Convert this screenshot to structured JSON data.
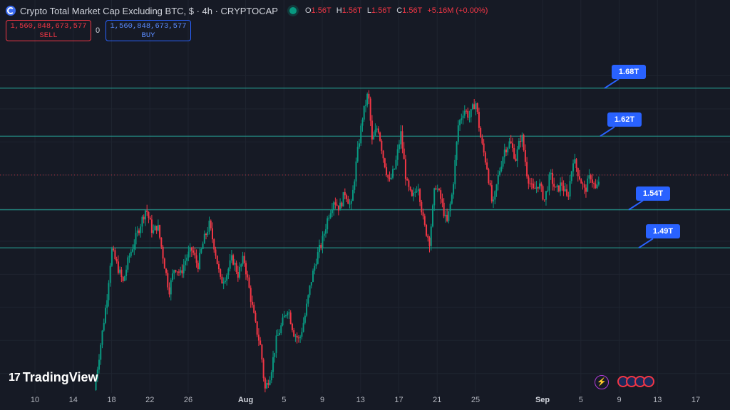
{
  "header": {
    "title": "Crypto Total Market Cap Excluding BTC, $ · 4h · CRYPTOCAP",
    "ohlc": {
      "o_label": "O",
      "o": "1.56T",
      "h_label": "H",
      "h": "1.56T",
      "l_label": "L",
      "l": "1.56T",
      "c_label": "C",
      "c": "1.56T",
      "change": "+5.16M (+0.00%)"
    },
    "status_color": "#089981"
  },
  "trade": {
    "sell_value": "1,560,848,673,577",
    "sell_label": "SELL",
    "spread": "0",
    "buy_value": "1,560,848,673,577",
    "buy_label": "BUY"
  },
  "brand": {
    "logo_mark": "17",
    "name": "TradingView"
  },
  "colors": {
    "up": "#089981",
    "down": "#f23645",
    "accent": "#2962ff",
    "level": "#26a69a",
    "background": "#161a25"
  },
  "icons": [
    "lightning-icon",
    "us-flag-icon"
  ],
  "chart_data": {
    "type": "candlestick",
    "ylim": [
      1.3,
      1.72
    ],
    "x_ticks": [
      {
        "label": "10",
        "day": 10
      },
      {
        "label": "14",
        "day": 14
      },
      {
        "label": "18",
        "day": 18
      },
      {
        "label": "22",
        "day": 22
      },
      {
        "label": "26",
        "day": 26
      },
      {
        "label": "Aug",
        "day": 32,
        "bold": true
      },
      {
        "label": "5",
        "day": 36
      },
      {
        "label": "9",
        "day": 40
      },
      {
        "label": "13",
        "day": 44
      },
      {
        "label": "17",
        "day": 48
      },
      {
        "label": "21",
        "day": 52
      },
      {
        "label": "25",
        "day": 56
      },
      {
        "label": "Sep",
        "day": 63,
        "bold": true
      },
      {
        "label": "5",
        "day": 67
      },
      {
        "label": "9",
        "day": 71
      },
      {
        "label": "13",
        "day": 75
      },
      {
        "label": "17",
        "day": 79
      }
    ],
    "levels": [
      {
        "label": "1.68T",
        "value": 1.665
      },
      {
        "label": "1.62T",
        "value": 1.607
      },
      {
        "label": "1.54T",
        "value": 1.518
      },
      {
        "label": "1.49T",
        "value": 1.472
      }
    ],
    "last_price": 1.56,
    "close_path": [
      [
        16.2,
        1.3
      ],
      [
        16.8,
        1.35
      ],
      [
        17.5,
        1.41
      ],
      [
        18.0,
        1.47
      ],
      [
        18.6,
        1.45
      ],
      [
        19.2,
        1.43
      ],
      [
        19.8,
        1.46
      ],
      [
        20.4,
        1.48
      ],
      [
        21.0,
        1.5
      ],
      [
        21.6,
        1.52
      ],
      [
        22.3,
        1.49
      ],
      [
        22.8,
        1.5
      ],
      [
        23.4,
        1.46
      ],
      [
        24.0,
        1.42
      ],
      [
        24.6,
        1.45
      ],
      [
        25.2,
        1.44
      ],
      [
        25.8,
        1.46
      ],
      [
        26.4,
        1.47
      ],
      [
        27.0,
        1.45
      ],
      [
        27.6,
        1.48
      ],
      [
        28.2,
        1.5
      ],
      [
        28.8,
        1.47
      ],
      [
        29.4,
        1.43
      ],
      [
        30.0,
        1.44
      ],
      [
        30.6,
        1.46
      ],
      [
        31.2,
        1.44
      ],
      [
        31.8,
        1.46
      ],
      [
        32.4,
        1.42
      ],
      [
        33.0,
        1.38
      ],
      [
        33.6,
        1.35
      ],
      [
        34.0,
        1.3
      ],
      [
        34.6,
        1.32
      ],
      [
        35.2,
        1.36
      ],
      [
        35.8,
        1.38
      ],
      [
        36.4,
        1.4
      ],
      [
        37.0,
        1.37
      ],
      [
        37.6,
        1.36
      ],
      [
        38.2,
        1.39
      ],
      [
        38.8,
        1.43
      ],
      [
        39.4,
        1.46
      ],
      [
        40.0,
        1.48
      ],
      [
        40.6,
        1.51
      ],
      [
        41.2,
        1.53
      ],
      [
        41.8,
        1.52
      ],
      [
        42.4,
        1.54
      ],
      [
        43.0,
        1.52
      ],
      [
        43.6,
        1.58
      ],
      [
        44.2,
        1.63
      ],
      [
        44.8,
        1.66
      ],
      [
        45.2,
        1.6
      ],
      [
        45.8,
        1.62
      ],
      [
        46.4,
        1.58
      ],
      [
        47.0,
        1.55
      ],
      [
        47.6,
        1.57
      ],
      [
        48.2,
        1.61
      ],
      [
        48.8,
        1.55
      ],
      [
        49.4,
        1.53
      ],
      [
        50.0,
        1.55
      ],
      [
        50.6,
        1.5
      ],
      [
        51.2,
        1.48
      ],
      [
        51.8,
        1.55
      ],
      [
        52.4,
        1.53
      ],
      [
        53.0,
        1.5
      ],
      [
        53.6,
        1.54
      ],
      [
        54.2,
        1.62
      ],
      [
        54.8,
        1.64
      ],
      [
        55.4,
        1.63
      ],
      [
        56.0,
        1.65
      ],
      [
        56.6,
        1.6
      ],
      [
        57.2,
        1.57
      ],
      [
        57.8,
        1.52
      ],
      [
        58.4,
        1.56
      ],
      [
        59.0,
        1.59
      ],
      [
        59.6,
        1.6
      ],
      [
        60.2,
        1.58
      ],
      [
        60.8,
        1.61
      ],
      [
        61.4,
        1.56
      ],
      [
        62.0,
        1.54
      ],
      [
        62.6,
        1.55
      ],
      [
        63.2,
        1.53
      ],
      [
        63.8,
        1.56
      ],
      [
        64.4,
        1.54
      ],
      [
        65.0,
        1.55
      ],
      [
        65.6,
        1.53
      ],
      [
        66.2,
        1.58
      ],
      [
        66.8,
        1.56
      ],
      [
        67.4,
        1.54
      ],
      [
        68.0,
        1.56
      ],
      [
        68.6,
        1.54
      ],
      [
        69.0,
        1.56
      ]
    ]
  }
}
